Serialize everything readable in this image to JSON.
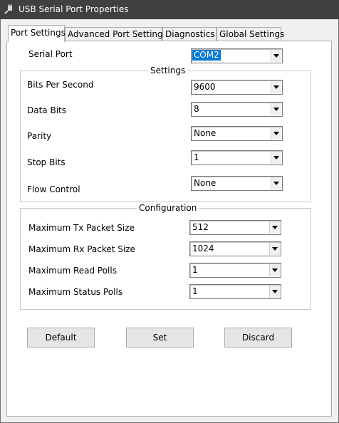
{
  "window": {
    "title": "USB Serial Port Properties",
    "app_icon": "usb-plug-icon"
  },
  "tabs": [
    {
      "label": "Port Settings",
      "active": true
    },
    {
      "label": "Advanced Port Settings",
      "active": false
    },
    {
      "label": "Diagnostics",
      "active": false
    },
    {
      "label": "Global Settings",
      "active": false
    }
  ],
  "serial_port": {
    "label": "Serial Port",
    "value": "COM2"
  },
  "settings": {
    "title": "Settings",
    "fields": [
      {
        "label": "Bits Per Second",
        "value": "9600"
      },
      {
        "label": "Data Bits",
        "value": "8"
      },
      {
        "label": "Parity",
        "value": "None"
      },
      {
        "label": "Stop Bits",
        "value": "1"
      },
      {
        "label": "Flow Control",
        "value": "None"
      }
    ]
  },
  "configuration": {
    "title": "Configuration",
    "fields": [
      {
        "label": "Maximum Tx Packet Size",
        "value": "512"
      },
      {
        "label": "Maximum Rx Packet Size",
        "value": "1024"
      },
      {
        "label": "Maximum Read Polls",
        "value": "1"
      },
      {
        "label": "Maximum Status Polls",
        "value": "1"
      }
    ]
  },
  "buttons": {
    "default": "Default",
    "set": "Set",
    "discard": "Discard"
  },
  "colors": {
    "titlebar": "#404040",
    "selection": "#0078d7",
    "panel": "#ffffff",
    "dialog": "#f0f0f0"
  }
}
